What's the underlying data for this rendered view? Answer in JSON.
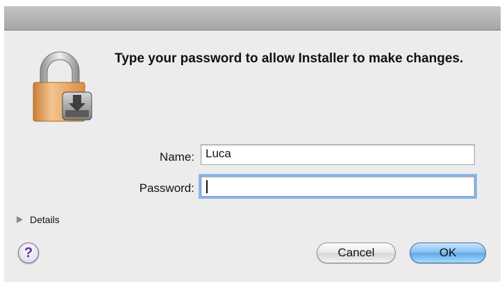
{
  "dialog": {
    "message": "Type your password to allow Installer to make changes.",
    "name_label": "Name:",
    "name_value": "Luca",
    "password_label": "Password:",
    "password_value": "",
    "details_label": "Details",
    "help_label": "?",
    "cancel_label": "Cancel",
    "ok_label": "OK"
  },
  "icons": {
    "lock": "lock-icon",
    "disclosure": "disclosure-triangle-icon",
    "help": "help-icon"
  },
  "colors": {
    "dialog_background": "#ececec",
    "focus_ring": "#8db6e8",
    "default_button": "#5fa7e8",
    "lock_body": "#e6a661"
  }
}
